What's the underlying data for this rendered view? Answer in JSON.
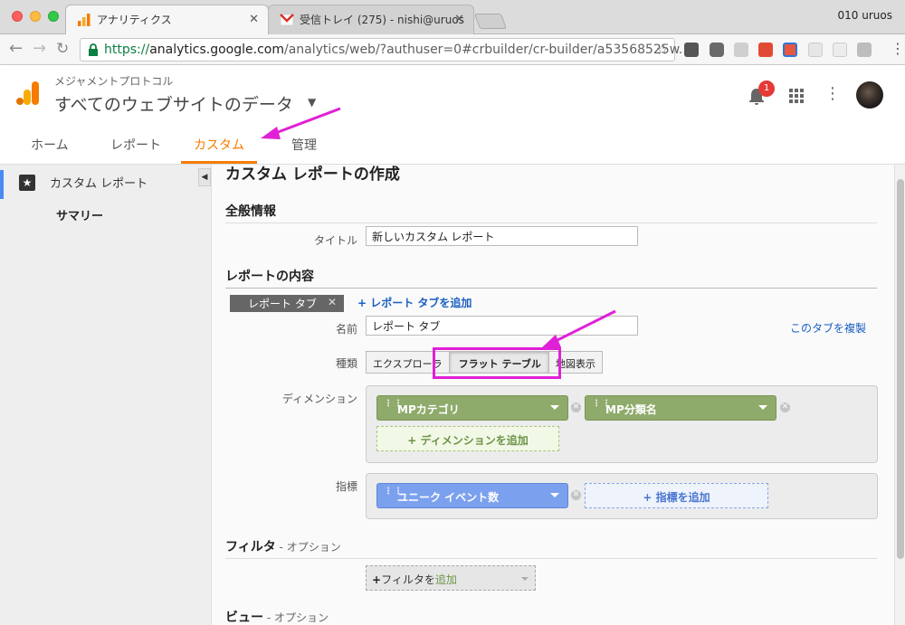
{
  "browser": {
    "active_tab": "アナリティクス",
    "inactive_tab": "受信トレイ (275) - nishi@uruos",
    "profile": "010 uruos",
    "url_scheme": "https://",
    "url_host": "analytics.google.com",
    "url_path": "/analytics/web/?authuser=0#crbuilder/cr-builder/a53568525w..."
  },
  "header": {
    "account": "メジャメントプロトコル",
    "property": "すべてのウェブサイトのデータ",
    "notification_count": "1"
  },
  "nav": {
    "home": "ホーム",
    "reports": "レポート",
    "custom": "カスタム",
    "admin": "管理"
  },
  "sidebar": {
    "item": "カスタム レポート",
    "sub": "サマリー"
  },
  "page": {
    "title": "カスタム レポートの作成",
    "general_heading": "全般情報",
    "title_label": "タイトル",
    "title_value": "新しいカスタム レポート",
    "content_heading": "レポートの内容",
    "report_tab": "レポート タブ",
    "add_tab": "+ レポート タブを追加",
    "name_label": "名前",
    "name_value": "レポート タブ",
    "duplicate": "このタブを複製",
    "type_label": "種類",
    "types": [
      "エクスプローラ",
      "フラット テーブル",
      "地図表示"
    ],
    "dimension_label": "ディメンション",
    "dimensions": [
      "MPカテゴリ",
      "MP分類名"
    ],
    "add_dimension": "+ ディメンションを追加",
    "metric_label": "指標",
    "metrics": [
      "ユニーク イベント数"
    ],
    "add_metric": "+ 指標を追加",
    "filter_heading": "フィルタ",
    "option": " - オプション",
    "filter_button_prefix": "+",
    "filter_button_text": "フィルタを",
    "filter_button_hl": "追加",
    "view_heading": "ビュー"
  }
}
